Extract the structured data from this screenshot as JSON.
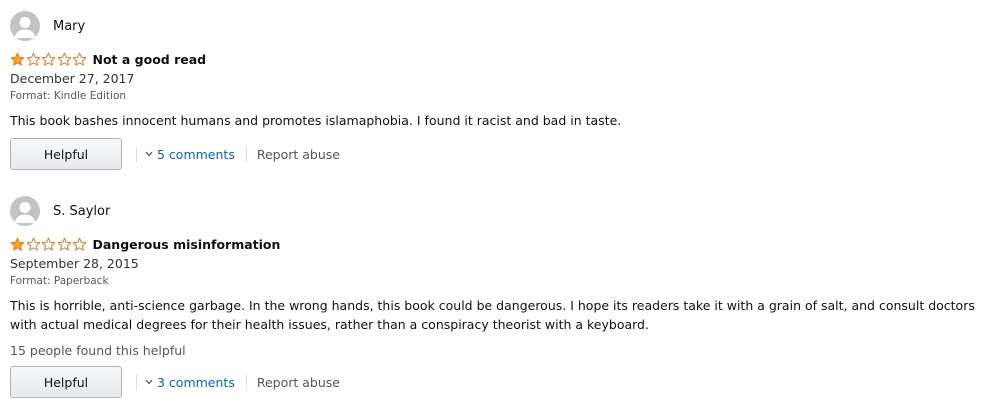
{
  "colors": {
    "star_fill": "#ffa41c",
    "star_outline": "#de7921",
    "link": "#0066c0",
    "muted_text": "#565959"
  },
  "reviews": [
    {
      "reviewer": "Mary",
      "rating": 1,
      "rating_max": 5,
      "title": "Not a good read",
      "date": "December 27, 2017",
      "format": "Format: Kindle Edition",
      "body": "This book bashes innocent humans and promotes islamaphobia. I found it racist and bad in taste.",
      "helpful_count": "",
      "helpful_label": "Helpful",
      "comments_label": "5 comments",
      "report_label": "Report abuse"
    },
    {
      "reviewer": "S. Saylor",
      "rating": 1,
      "rating_max": 5,
      "title": "Dangerous misinformation",
      "date": "September 28, 2015",
      "format": "Format: Paperback",
      "body": "This is horrible, anti-science garbage. In the wrong hands, this book could be dangerous. I hope its readers take it with a grain of salt, and consult doctors with actual medical degrees for their health issues, rather than a conspiracy theorist with a keyboard.",
      "helpful_count": "15 people found this helpful",
      "helpful_label": "Helpful",
      "comments_label": "3 comments",
      "report_label": "Report abuse"
    }
  ]
}
